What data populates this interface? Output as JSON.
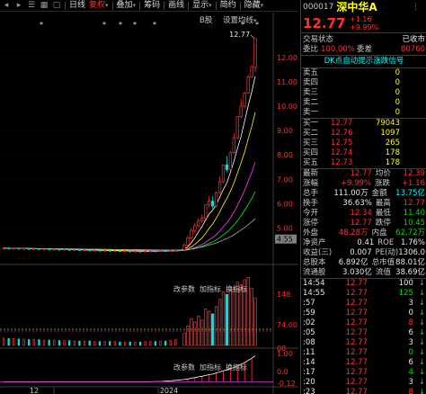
{
  "toolbar": {
    "period_label": "日线",
    "buttons": [
      {
        "label": "复权",
        "caret": "▾",
        "active": true
      },
      {
        "label": "叠加",
        "caret": "▾",
        "active": false
      },
      {
        "label": "筹码",
        "caret": "",
        "active": false
      },
      {
        "label": "画线",
        "caret": "",
        "active": false
      },
      {
        "label": "显示",
        "caret": "▾",
        "active": false
      },
      {
        "label": "简约",
        "caret": "",
        "active": false
      },
      {
        "label": "隐藏",
        "caret": "▾",
        "active": false
      }
    ]
  },
  "chart_header": {
    "b_label": "B股",
    "settings_label": "设置均线",
    "settings_caret": "▾"
  },
  "chart_data": {
    "type": "candlestick",
    "price_axis_ticks": [
      "12.00",
      "11.00",
      "10.00",
      "9.00",
      "8.00",
      "7.00",
      "6.00",
      "5.00",
      "4.55"
    ],
    "high_label": "12.77",
    "current_price_tag": "4.55",
    "x_labels": [
      "12",
      "2024"
    ],
    "vol_panel": {
      "tools": [
        "改参数",
        "加指标",
        "换指标"
      ],
      "axis_ticks": [
        "148.",
        "74.00",
        "00"
      ]
    },
    "ind_panel": {
      "tools": [
        "改参数",
        "加指标",
        "换指标"
      ],
      "axis_ticks": [
        "1.00",
        "0.0",
        "-0.12"
      ]
    },
    "candles": [
      {
        "o": 4.18,
        "c": 4.18,
        "h": 4.22,
        "l": 4.15
      },
      {
        "o": 4.18,
        "c": 4.16,
        "h": 4.21,
        "l": 4.13
      },
      {
        "o": 4.16,
        "c": 4.17,
        "h": 4.2,
        "l": 4.13
      },
      {
        "o": 4.17,
        "c": 4.15,
        "h": 4.19,
        "l": 4.12
      },
      {
        "o": 4.15,
        "c": 4.16,
        "h": 4.19,
        "l": 4.12
      },
      {
        "o": 4.16,
        "c": 4.14,
        "h": 4.18,
        "l": 4.11
      },
      {
        "o": 4.14,
        "c": 4.15,
        "h": 4.18,
        "l": 4.11
      },
      {
        "o": 4.15,
        "c": 4.13,
        "h": 4.17,
        "l": 4.1
      },
      {
        "o": 4.13,
        "c": 4.14,
        "h": 4.17,
        "l": 4.1
      },
      {
        "o": 4.14,
        "c": 4.12,
        "h": 4.16,
        "l": 4.09
      },
      {
        "o": 4.12,
        "c": 4.13,
        "h": 4.16,
        "l": 4.09
      },
      {
        "o": 4.13,
        "c": 4.11,
        "h": 4.15,
        "l": 4.08
      },
      {
        "o": 4.11,
        "c": 4.12,
        "h": 4.15,
        "l": 4.08
      },
      {
        "o": 4.12,
        "c": 4.1,
        "h": 4.14,
        "l": 4.07
      },
      {
        "o": 4.1,
        "c": 4.11,
        "h": 4.14,
        "l": 4.07
      },
      {
        "o": 4.11,
        "c": 4.09,
        "h": 4.13,
        "l": 4.06
      },
      {
        "o": 4.09,
        "c": 4.1,
        "h": 4.13,
        "l": 4.06
      },
      {
        "o": 4.1,
        "c": 4.08,
        "h": 4.12,
        "l": 4.05
      },
      {
        "o": 4.08,
        "c": 4.09,
        "h": 4.12,
        "l": 4.05
      },
      {
        "o": 4.09,
        "c": 4.07,
        "h": 4.11,
        "l": 4.04
      },
      {
        "o": 4.07,
        "c": 4.08,
        "h": 4.11,
        "l": 4.04
      },
      {
        "o": 4.08,
        "c": 4.06,
        "h": 4.1,
        "l": 4.03
      },
      {
        "o": 4.06,
        "c": 4.07,
        "h": 4.1,
        "l": 4.03
      },
      {
        "o": 4.07,
        "c": 4.05,
        "h": 4.09,
        "l": 4.02
      },
      {
        "o": 4.05,
        "c": 4.06,
        "h": 4.09,
        "l": 4.02
      },
      {
        "o": 4.06,
        "c": 4.04,
        "h": 4.08,
        "l": 4.01
      },
      {
        "o": 4.04,
        "c": 4.05,
        "h": 4.08,
        "l": 4.01
      },
      {
        "o": 4.05,
        "c": 4.04,
        "h": 4.07,
        "l": 4.0
      },
      {
        "o": 4.04,
        "c": 4.05,
        "h": 4.08,
        "l": 4.01
      },
      {
        "o": 4.05,
        "c": 4.06,
        "h": 4.09,
        "l": 4.02
      },
      {
        "o": 4.06,
        "c": 4.05,
        "h": 4.09,
        "l": 4.02
      },
      {
        "o": 4.05,
        "c": 4.07,
        "h": 4.1,
        "l": 4.03
      },
      {
        "o": 4.07,
        "c": 4.06,
        "h": 4.1,
        "l": 4.03
      },
      {
        "o": 4.06,
        "c": 4.08,
        "h": 4.11,
        "l": 4.04
      },
      {
        "o": 4.08,
        "c": 4.1,
        "h": 4.14,
        "l": 4.06
      },
      {
        "o": 4.1,
        "c": 4.3,
        "h": 4.4,
        "l": 4.08
      },
      {
        "o": 4.3,
        "c": 4.6,
        "h": 4.7,
        "l": 4.25
      },
      {
        "o": 4.6,
        "c": 4.9,
        "h": 5.0,
        "l": 4.55
      },
      {
        "o": 4.9,
        "c": 5.1,
        "h": 5.2,
        "l": 4.8
      },
      {
        "o": 5.1,
        "c": 5.3,
        "h": 5.4,
        "l": 5.0
      },
      {
        "o": 5.3,
        "c": 5.4,
        "h": 5.55,
        "l": 5.2
      },
      {
        "o": 5.4,
        "c": 5.95,
        "h": 5.95,
        "l": 5.35
      },
      {
        "o": 5.95,
        "c": 6.1,
        "h": 6.3,
        "l": 5.85
      },
      {
        "o": 6.1,
        "c": 5.9,
        "h": 6.3,
        "l": 5.8
      },
      {
        "o": 5.9,
        "c": 6.45,
        "h": 6.5,
        "l": 5.85
      },
      {
        "o": 6.45,
        "c": 6.9,
        "h": 7.1,
        "l": 6.4
      },
      {
        "o": 6.9,
        "c": 7.59,
        "h": 7.6,
        "l": 6.85
      },
      {
        "o": 7.59,
        "c": 7.4,
        "h": 7.95,
        "l": 7.3
      },
      {
        "o": 7.4,
        "c": 8.1,
        "h": 8.15,
        "l": 7.35
      },
      {
        "o": 8.1,
        "c": 8.7,
        "h": 8.9,
        "l": 8.05
      },
      {
        "o": 8.7,
        "c": 9.58,
        "h": 9.6,
        "l": 8.65
      },
      {
        "o": 9.58,
        "c": 10.0,
        "h": 10.3,
        "l": 9.5
      },
      {
        "o": 10.0,
        "c": 10.54,
        "h": 10.6,
        "l": 9.9
      },
      {
        "o": 10.54,
        "c": 11.2,
        "h": 11.3,
        "l": 10.5
      },
      {
        "o": 11.2,
        "c": 11.61,
        "h": 11.7,
        "l": 11.15
      },
      {
        "o": 11.61,
        "c": 12.77,
        "h": 12.77,
        "l": 11.4
      }
    ],
    "volume": [
      15,
      14,
      14,
      13,
      13,
      12,
      12,
      12,
      11,
      11,
      11,
      10,
      10,
      10,
      9,
      9,
      9,
      9,
      8,
      8,
      8,
      8,
      8,
      7,
      7,
      7,
      7,
      7,
      8,
      8,
      8,
      9,
      9,
      10,
      12,
      25,
      40,
      55,
      48,
      60,
      52,
      75,
      70,
      65,
      80,
      95,
      110,
      105,
      115,
      120,
      130,
      125,
      135,
      140,
      118,
      98
    ],
    "indicator": [
      0,
      0,
      0,
      0,
      0,
      0,
      0,
      0,
      0,
      0,
      0,
      0,
      0,
      0,
      0,
      0,
      0,
      0,
      0,
      0,
      0,
      0,
      0,
      0,
      0,
      0,
      0,
      0,
      0,
      0,
      0.01,
      0.01,
      0.02,
      0.03,
      0.05,
      0.08,
      0.1,
      0.13,
      0.15,
      0.18,
      0.2,
      0.23,
      0.26,
      0.28,
      0.32,
      0.36,
      0.4,
      0.44,
      0.48,
      0.52,
      0.58,
      0.64,
      0.7,
      0.78,
      0.86,
      0.95
    ]
  },
  "panel": {
    "code": "000017",
    "name": "深中华A",
    "price": "12.77",
    "change": "+1.16",
    "change_pct": "+9.99%",
    "trade_status_label": "交易状态",
    "trade_status_value": "已收市",
    "weibi_label": "委比",
    "weibi_value": "100.00%",
    "weicha_label": "委差",
    "weicha_value": "80760",
    "dk_signal": "DK点自动提示涨跌信号",
    "sells": [
      {
        "label": "卖五",
        "price": "",
        "vol": "0"
      },
      {
        "label": "卖四",
        "price": "",
        "vol": "0"
      },
      {
        "label": "卖三",
        "price": "",
        "vol": "0"
      },
      {
        "label": "卖二",
        "price": "",
        "vol": "0"
      },
      {
        "label": "卖一",
        "price": "",
        "vol": "0"
      }
    ],
    "buys": [
      {
        "label": "买一",
        "price": "12.77",
        "vol": "79043"
      },
      {
        "label": "买二",
        "price": "12.76",
        "vol": "1097"
      },
      {
        "label": "买三",
        "price": "12.75",
        "vol": "265"
      },
      {
        "label": "买四",
        "price": "12.74",
        "vol": "178"
      },
      {
        "label": "买五",
        "price": "12.73",
        "vol": "178"
      }
    ],
    "stats": [
      {
        "l1": "最新",
        "v1": "12.77",
        "c1": "red",
        "l2": "均价",
        "v2": "12.39",
        "c2": "red"
      },
      {
        "l1": "涨幅",
        "v1": "+9.99%",
        "c1": "red",
        "l2": "涨跌",
        "v2": "+1.16",
        "c2": "red"
      },
      {
        "l1": "总手",
        "v1": "111.00万",
        "c1": "wht",
        "l2": "金额",
        "v2": "13.75亿",
        "c2": "cyan"
      },
      {
        "l1": "换手",
        "v1": "36.63%",
        "c1": "wht",
        "l2": "最高",
        "v2": "12.77",
        "c2": "red"
      },
      {
        "l1": "今开",
        "v1": "12.34",
        "c1": "red",
        "l2": "最低",
        "v2": "11.40",
        "c2": "green"
      },
      {
        "l1": "涨停",
        "v1": "12.77",
        "c1": "red",
        "l2": "跌停",
        "v2": "10.45",
        "c2": "green"
      },
      {
        "l1": "外盘",
        "v1": "48.28万",
        "c1": "red",
        "l2": "内盘",
        "v2": "62.72万",
        "c2": "green"
      },
      {
        "l1": "净资产",
        "v1": "0.41",
        "c1": "wht",
        "l2": "ROE",
        "v2": "1.76%",
        "c2": "wht"
      },
      {
        "l1": "收益(三)",
        "v1": "0.007",
        "c1": "wht",
        "l2": "PE(动)",
        "v2": "1306.0",
        "c2": "wht"
      },
      {
        "l1": "总股本",
        "v1": "6.892亿",
        "c1": "wht",
        "l2": "总市值",
        "v2": "88.01亿",
        "c2": "wht"
      },
      {
        "l1": "流通股",
        "v1": "3.030亿",
        "c1": "wht",
        "l2": "流值",
        "v2": "38.69亿",
        "c2": "wht"
      }
    ],
    "ticks": [
      {
        "time": "14:54",
        "price": "12.77",
        "pc": "red",
        "vol": "100",
        "vc": "wht",
        "dir": "↓",
        "dc": "green"
      },
      {
        "time": "14:55",
        "price": "12.77",
        "pc": "red",
        "vol": "125",
        "vc": "green",
        "dir": "↓",
        "dc": "green"
      },
      {
        "time": ":57",
        "price": "12.77",
        "pc": "red",
        "vol": "3",
        "vc": "wht",
        "dir": "↓",
        "dc": "green"
      },
      {
        "time": ":59",
        "price": "12.77",
        "pc": "red",
        "vol": "0",
        "vc": "wht",
        "dir": "↓",
        "dc": "green"
      },
      {
        "time": ":02",
        "price": "12.77",
        "pc": "red",
        "vol": "8",
        "vc": "red",
        "dir": "↓",
        "dc": "green"
      },
      {
        "time": ":05",
        "price": "12.77",
        "pc": "red",
        "vol": "6",
        "vc": "wht",
        "dir": "↓",
        "dc": "green"
      },
      {
        "time": ":08",
        "price": "12.77",
        "pc": "red",
        "vol": "3",
        "vc": "wht",
        "dir": "↓",
        "dc": "green"
      },
      {
        "time": ":11",
        "price": "12.77",
        "pc": "red",
        "vol": "0",
        "vc": "green",
        "dir": "↓",
        "dc": "green"
      },
      {
        "time": ":14",
        "price": "12.77",
        "pc": "red",
        "vol": "6",
        "vc": "wht",
        "dir": "↓",
        "dc": "green"
      },
      {
        "time": ":17",
        "price": "12.77",
        "pc": "red",
        "vol": "4",
        "vc": "green",
        "dir": "↓",
        "dc": "green"
      },
      {
        "time": ":20",
        "price": "12.77",
        "pc": "red",
        "vol": "3",
        "vc": "wht",
        "dir": "↓",
        "dc": "green"
      },
      {
        "time": ":23",
        "price": "12.77",
        "pc": "red",
        "vol": "8",
        "vc": "red",
        "dir": "↓",
        "dc": "green"
      }
    ]
  }
}
